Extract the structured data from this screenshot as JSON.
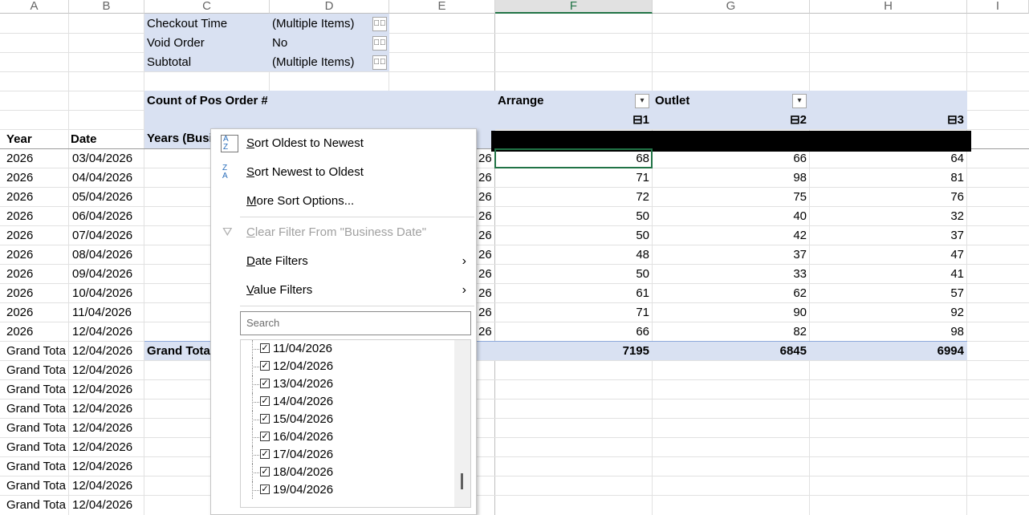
{
  "columns": [
    "A",
    "B",
    "C",
    "D",
    "E",
    "F",
    "G",
    "H",
    "I"
  ],
  "report_filters": [
    {
      "label": "Checkout Time",
      "value": "(Multiple Items)"
    },
    {
      "label": "Void Order",
      "value": "No"
    },
    {
      "label": "Subtotal",
      "value": "(Multiple Items)"
    }
  ],
  "pivot": {
    "value_label": "Count of Pos Order #",
    "arrange_label": "Arrange",
    "outlet_label": "Outlet",
    "outlet_values": [
      "1",
      "2",
      "3"
    ],
    "row_label": "Years (Busi",
    "year_header": "Year",
    "date_header": "Date",
    "rows": [
      {
        "year": "2026",
        "date": "03/04/2026",
        "e": "26",
        "f": "68",
        "g": "66",
        "h": "64"
      },
      {
        "year": "2026",
        "date": "04/04/2026",
        "e": "26",
        "f": "71",
        "g": "98",
        "h": "81"
      },
      {
        "year": "2026",
        "date": "05/04/2026",
        "e": "26",
        "f": "72",
        "g": "75",
        "h": "76"
      },
      {
        "year": "2026",
        "date": "06/04/2026",
        "e": "26",
        "f": "50",
        "g": "40",
        "h": "32"
      },
      {
        "year": "2026",
        "date": "07/04/2026",
        "e": "26",
        "f": "50",
        "g": "42",
        "h": "37"
      },
      {
        "year": "2026",
        "date": "08/04/2026",
        "e": "26",
        "f": "48",
        "g": "37",
        "h": "47"
      },
      {
        "year": "2026",
        "date": "09/04/2026",
        "e": "26",
        "f": "50",
        "g": "33",
        "h": "41"
      },
      {
        "year": "2026",
        "date": "10/04/2026",
        "e": "26",
        "f": "61",
        "g": "62",
        "h": "57"
      },
      {
        "year": "2026",
        "date": "11/04/2026",
        "e": "26",
        "f": "71",
        "g": "90",
        "h": "92"
      },
      {
        "year": "2026",
        "date": "12/04/2026",
        "e": "26",
        "f": "66",
        "g": "82",
        "h": "98"
      }
    ],
    "grand_total_label": "Grand Tota",
    "grand_total_row": {
      "a": "Grand Tota",
      "b": "12/04/2026",
      "f": "7195",
      "g": "6845",
      "h": "6994"
    },
    "extra_rows": [
      {
        "a": "Grand Tota",
        "b": "12/04/2026"
      },
      {
        "a": "Grand Tota",
        "b": "12/04/2026"
      },
      {
        "a": "Grand Tota",
        "b": "12/04/2026"
      },
      {
        "a": "Grand Tota",
        "b": "12/04/2026"
      },
      {
        "a": "Grand Tota",
        "b": "12/04/2026"
      },
      {
        "a": "Grand Tota",
        "b": "12/04/2026"
      },
      {
        "a": "Grand Tota",
        "b": "12/04/2026"
      },
      {
        "a": "Grand Tota",
        "b": "12/04/2026"
      }
    ]
  },
  "menu": {
    "sort_asc": "Sort Oldest to Newest",
    "sort_desc": "Sort Newest to Oldest",
    "more_sort": "More Sort Options...",
    "clear_filter": "Clear Filter From \"Business Date\"",
    "date_filters": "Date Filters",
    "value_filters": "Value Filters",
    "search_placeholder": "Search",
    "items": [
      "11/04/2026",
      "12/04/2026",
      "13/04/2026",
      "14/04/2026",
      "15/04/2026",
      "16/04/2026",
      "17/04/2026",
      "18/04/2026",
      "19/04/2026"
    ]
  },
  "colors": {
    "pivot_fill": "#d9e1f2",
    "active_cell": "#217346"
  }
}
